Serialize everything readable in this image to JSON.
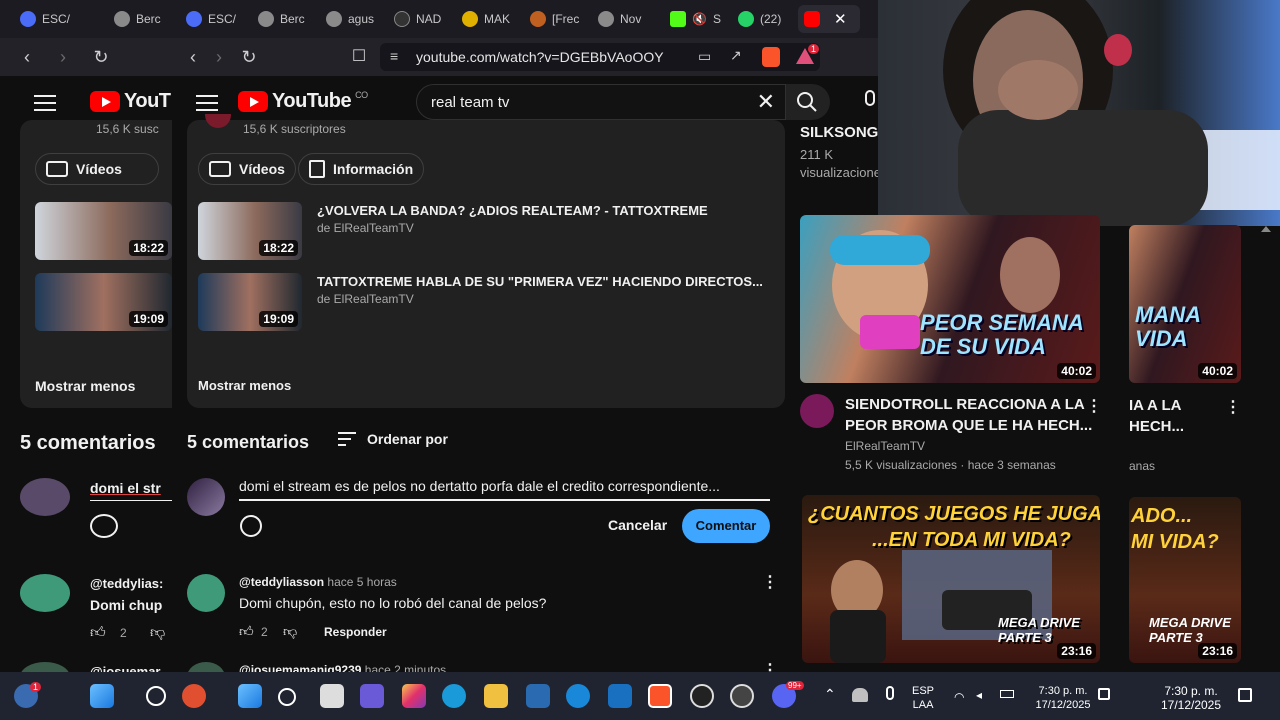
{
  "tabs": [
    {
      "label": "ESC/",
      "color": "#4a6cf7"
    },
    {
      "label": "Berc",
      "color": "#8a8a8a"
    },
    {
      "label": "ESC/",
      "color": "#4a6cf7"
    },
    {
      "label": "Berc",
      "color": "#8a8a8a"
    },
    {
      "label": "agus",
      "color": "#8a8a8a"
    },
    {
      "label": "NAD",
      "color": "#333333"
    },
    {
      "label": "MAK",
      "color": "#e0b000"
    },
    {
      "label": "[Frec",
      "color": "#c06020"
    },
    {
      "label": "Nov",
      "color": "#8a8a8a"
    },
    {
      "label": "S",
      "color": "#53fc18"
    },
    {
      "label": "(22)",
      "color": "#25d366"
    }
  ],
  "browser": {
    "url": "youtube.com/watch?v=DGEBbVAoOOY",
    "ext_badge": "1"
  },
  "youtube": {
    "logo_left": "YouT",
    "logo": "YouTube",
    "country": "CO",
    "search_query": "real team tv"
  },
  "playlist": {
    "subs_left": "15,6 K susc",
    "subs": "15,6 K suscriptores",
    "chip_videos": "Vídeos",
    "chip_info": "Información",
    "videos": [
      {
        "title": "¿VOLVERA LA BANDA? ¿ADIOS REALTEAM? - TATTOXTREME",
        "channel": "de ElRealTeamTV",
        "duration": "18:22"
      },
      {
        "title": "TATTOXTREME HABLA DE SU \"PRIMERA VEZ\" HACIENDO DIRECTOS...",
        "channel": "de ElRealTeamTV",
        "duration": "19:09"
      }
    ],
    "show_less": "Mostrar menos"
  },
  "comments": {
    "count_left": "5 comentarios",
    "count": "5 comentarios",
    "sort": "Ordenar por",
    "draft_left": "domi el str",
    "draft": "domi el stream es de pelos no dertatto porfa dale el credito correspondiente...",
    "cancel": "Cancelar",
    "submit": "Comentar",
    "items": [
      {
        "user": "@teddyliasson",
        "user_left": "@teddylias:",
        "time": "hace 5 horas",
        "text": "Domi chupón, esto no lo robó del canal de pelos?",
        "text_left": "Domi chup",
        "likes": "2",
        "reply": "Responder"
      },
      {
        "user": "@josuemamanig9239",
        "user_left": "@josuemar",
        "time": "hace 2 minutos"
      }
    ]
  },
  "sidebar": {
    "top_title": "SILKSONG ...",
    "top_views": "211 K",
    "top_views2": "visualizaciones",
    "videos": [
      {
        "title_line1": "SIENDOTROLL REACCIONA A LA",
        "title_line2": "PEOR BROMA QUE LE HA HECH...",
        "channel": "ElRealTeamTV",
        "meta": "5,5 K visualizaciones · hace 3 semanas",
        "duration": "40:02",
        "thumb_text": "PEOR SEMANA DE SU VIDA",
        "clip_line1": "IA A LA",
        "clip_line2": "HECH...",
        "clip_meta": "anas",
        "clip_text": "MANA VIDA"
      },
      {
        "duration": "23:16",
        "thumb_text_top": "¿CUANTOS JUEGOS HE JUGADO...",
        "thumb_text_mid": "...EN TODA MI VIDA?",
        "thumb_text_bot": "MEGA DRIVE PARTE 3",
        "clip_top": "ADO...",
        "clip_mid": "MI VIDA?",
        "clip_bot": "MEGA DRIVE PARTE 3"
      }
    ]
  },
  "taskbar": {
    "lang": "ESP",
    "lang2": "LAA",
    "time": "7:30 p. m.",
    "date": "17/12/2025",
    "time_right": "7:30 p. m.",
    "date_right": "17/12/2025",
    "notif_badge": "1",
    "discord_badge": "99+"
  }
}
